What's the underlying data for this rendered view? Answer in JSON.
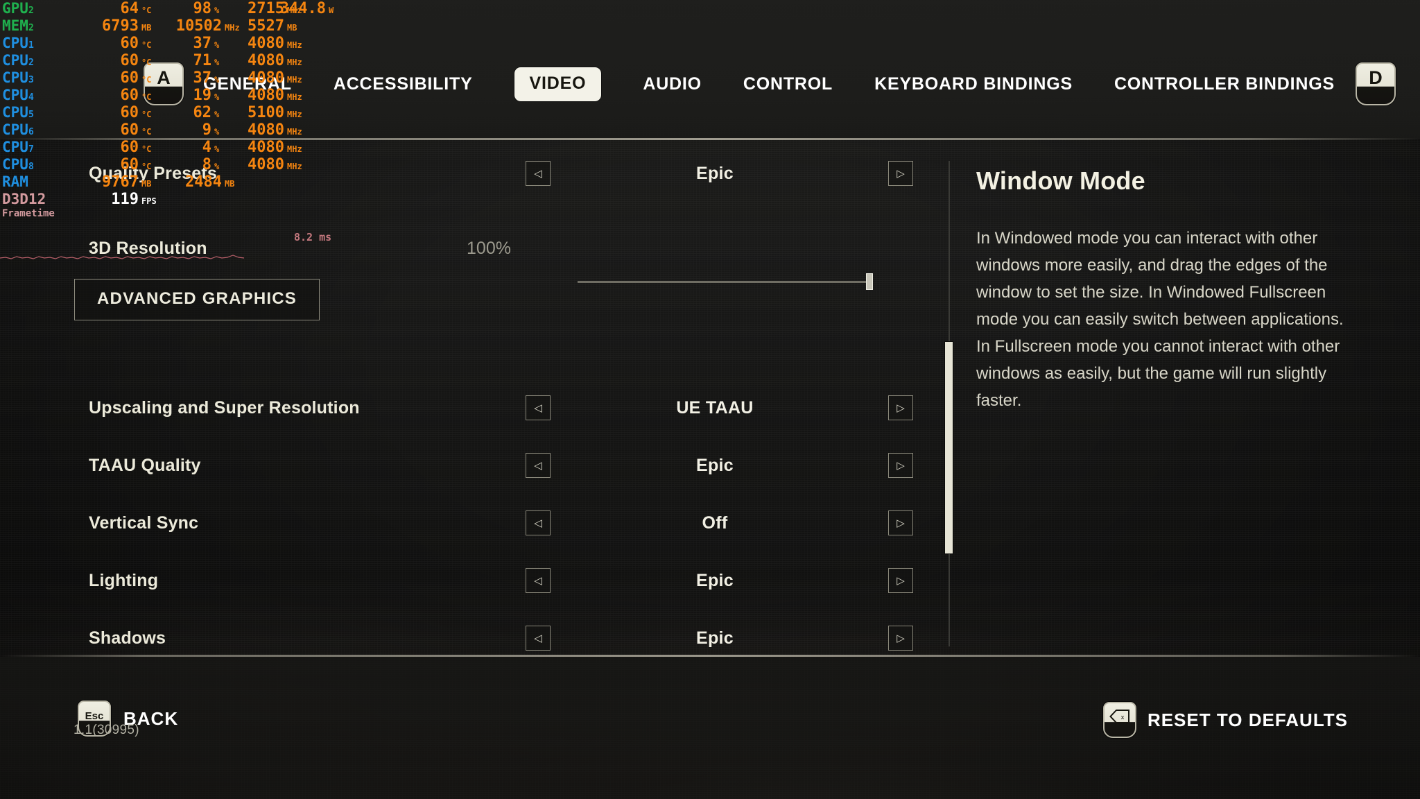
{
  "header": {
    "prev_key": "A",
    "next_key": "D",
    "tabs": [
      {
        "label": "GENERAL",
        "active": false
      },
      {
        "label": "ACCESSIBILITY",
        "active": false
      },
      {
        "label": "VIDEO",
        "active": true
      },
      {
        "label": "AUDIO",
        "active": false
      },
      {
        "label": "CONTROL",
        "active": false
      },
      {
        "label": "KEYBOARD BINDINGS",
        "active": false
      },
      {
        "label": "CONTROLLER BINDINGS",
        "active": false
      }
    ]
  },
  "settings": {
    "advanced_graphics_button": "ADVANCED GRAPHICS",
    "rows": [
      {
        "label": "Quality Presets",
        "value": "Epic",
        "type": "stepper"
      },
      {
        "label": "3D Resolution",
        "value": "100%",
        "type": "slider",
        "slider_percent": 100
      },
      {
        "label": "Upscaling and Super Resolution",
        "value": "UE TAAU",
        "type": "stepper"
      },
      {
        "label": "TAAU Quality",
        "value": "Epic",
        "type": "stepper"
      },
      {
        "label": "Vertical Sync",
        "value": "Off",
        "type": "stepper"
      },
      {
        "label": "Lighting",
        "value": "Epic",
        "type": "stepper"
      },
      {
        "label": "Shadows",
        "value": "Epic",
        "type": "stepper"
      }
    ]
  },
  "description": {
    "title": "Window Mode",
    "body": "In Windowed mode you can interact with other windows more easily, and drag the edges of the window to set the size. In Windowed Fullscreen mode you can easily switch between applications. In Fullscreen mode you cannot interact with other windows as easily, but the game will run slightly faster."
  },
  "bottom": {
    "back_key": "Esc",
    "back_label": "BACK",
    "reset_key": "backspace-icon",
    "reset_label": "RESET TO DEFAULTS",
    "version": "1.1(30995)"
  },
  "hardware_monitor": {
    "rows": [
      {
        "tag": "GPU",
        "sub": "2",
        "color": "gpu",
        "cells": [
          {
            "value": "64",
            "unit": "°C"
          },
          {
            "value": "98",
            "unit": "%"
          },
          {
            "value": "2715",
            "unit": "MHz"
          },
          {
            "value": "344.8",
            "unit": "W"
          }
        ]
      },
      {
        "tag": "MEM",
        "sub": "2",
        "color": "gpu",
        "cells": [
          {
            "value": "6793",
            "unit": "MB"
          },
          {
            "value": "10502",
            "unit": "MHz"
          },
          {
            "value": "5527",
            "unit": "MB"
          }
        ]
      },
      {
        "tag": "CPU",
        "sub": "1",
        "color": "cpu",
        "cells": [
          {
            "value": "60",
            "unit": "°C"
          },
          {
            "value": "37",
            "unit": "%"
          },
          {
            "value": "4080",
            "unit": "MHz"
          }
        ]
      },
      {
        "tag": "CPU",
        "sub": "2",
        "color": "cpu",
        "cells": [
          {
            "value": "60",
            "unit": "°C"
          },
          {
            "value": "71",
            "unit": "%"
          },
          {
            "value": "4080",
            "unit": "MHz"
          }
        ]
      },
      {
        "tag": "CPU",
        "sub": "3",
        "color": "cpu",
        "cells": [
          {
            "value": "60",
            "unit": "°C"
          },
          {
            "value": "37",
            "unit": "%"
          },
          {
            "value": "4080",
            "unit": "MHz"
          }
        ]
      },
      {
        "tag": "CPU",
        "sub": "4",
        "color": "cpu",
        "cells": [
          {
            "value": "60",
            "unit": "°C"
          },
          {
            "value": "19",
            "unit": "%"
          },
          {
            "value": "4080",
            "unit": "MHz"
          }
        ]
      },
      {
        "tag": "CPU",
        "sub": "5",
        "color": "cpu",
        "cells": [
          {
            "value": "60",
            "unit": "°C"
          },
          {
            "value": "62",
            "unit": "%"
          },
          {
            "value": "5100",
            "unit": "MHz"
          }
        ]
      },
      {
        "tag": "CPU",
        "sub": "6",
        "color": "cpu",
        "cells": [
          {
            "value": "60",
            "unit": "°C"
          },
          {
            "value": "9",
            "unit": "%"
          },
          {
            "value": "4080",
            "unit": "MHz"
          }
        ]
      },
      {
        "tag": "CPU",
        "sub": "7",
        "color": "cpu",
        "cells": [
          {
            "value": "60",
            "unit": "°C"
          },
          {
            "value": "4",
            "unit": "%"
          },
          {
            "value": "4080",
            "unit": "MHz"
          }
        ]
      },
      {
        "tag": "CPU",
        "sub": "8",
        "color": "cpu",
        "cells": [
          {
            "value": "60",
            "unit": "°C"
          },
          {
            "value": "8",
            "unit": "%"
          },
          {
            "value": "4080",
            "unit": "MHz"
          }
        ]
      },
      {
        "tag": "RAM",
        "sub": "",
        "color": "cpu",
        "cells": [
          {
            "value": "9767",
            "unit": "MB"
          },
          {
            "value": "2484",
            "unit": "MB"
          }
        ]
      },
      {
        "tag": "D3D12",
        "sub": "",
        "color": "d3d",
        "white": true,
        "cells": [
          {
            "value": "119",
            "unit": "FPS"
          }
        ]
      }
    ],
    "frametime_label": "Frametime",
    "frametime_value": "8.2 ms"
  }
}
